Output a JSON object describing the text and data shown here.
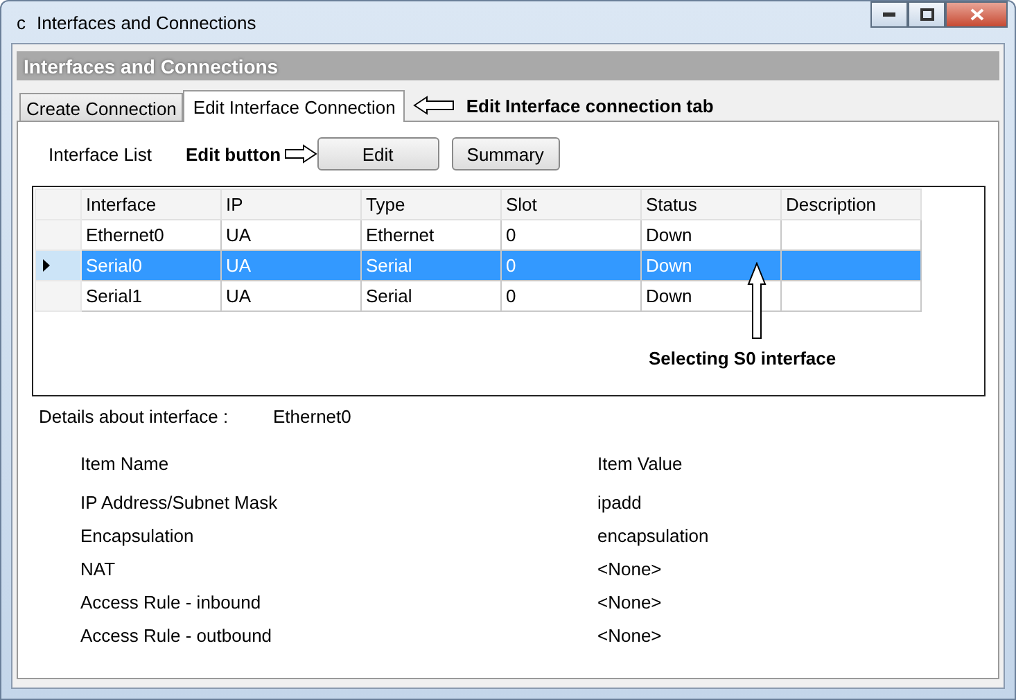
{
  "window": {
    "title_icon": "c",
    "title": "Interfaces and Connections"
  },
  "header": "Interfaces and Connections",
  "tabs": [
    {
      "label": "Create Connection",
      "selected": false
    },
    {
      "label": "Edit Interface Connection",
      "selected": true
    }
  ],
  "interface_list_label": "Interface List",
  "buttons": [
    "Edit",
    "Summary"
  ],
  "table": {
    "columns": [
      "Interface",
      "IP",
      "Type",
      "Slot",
      "Status",
      "Description"
    ],
    "rows": [
      {
        "cells": [
          "Ethernet0",
          "UA",
          "Ethernet",
          "0",
          "Down",
          ""
        ],
        "selected": false
      },
      {
        "cells": [
          "Serial0",
          "UA",
          "Serial",
          "0",
          "Down",
          ""
        ],
        "selected": true
      },
      {
        "cells": [
          "Serial1",
          "UA",
          "Serial",
          "0",
          "Down",
          ""
        ],
        "selected": false
      }
    ]
  },
  "details": {
    "label": "Details about interface  :",
    "value": "Ethernet0",
    "columns": [
      "Item Name",
      "Item Value"
    ],
    "items": [
      {
        "name": "IP Address/Subnet Mask",
        "value": "ipadd"
      },
      {
        "name": "Encapsulation",
        "value": "encapsulation"
      },
      {
        "name": "NAT",
        "value": "<None>"
      },
      {
        "name": "Access Rule - inbound",
        "value": "<None>"
      },
      {
        "name": "Access Rule - outbound",
        "value": "<None>"
      }
    ]
  },
  "annotations": [
    {
      "kind": "tab",
      "text": "Edit Interface connection tab"
    },
    {
      "kind": "button",
      "text": "Edit button"
    },
    {
      "kind": "row",
      "text": "Selecting S0 interface"
    }
  ]
}
